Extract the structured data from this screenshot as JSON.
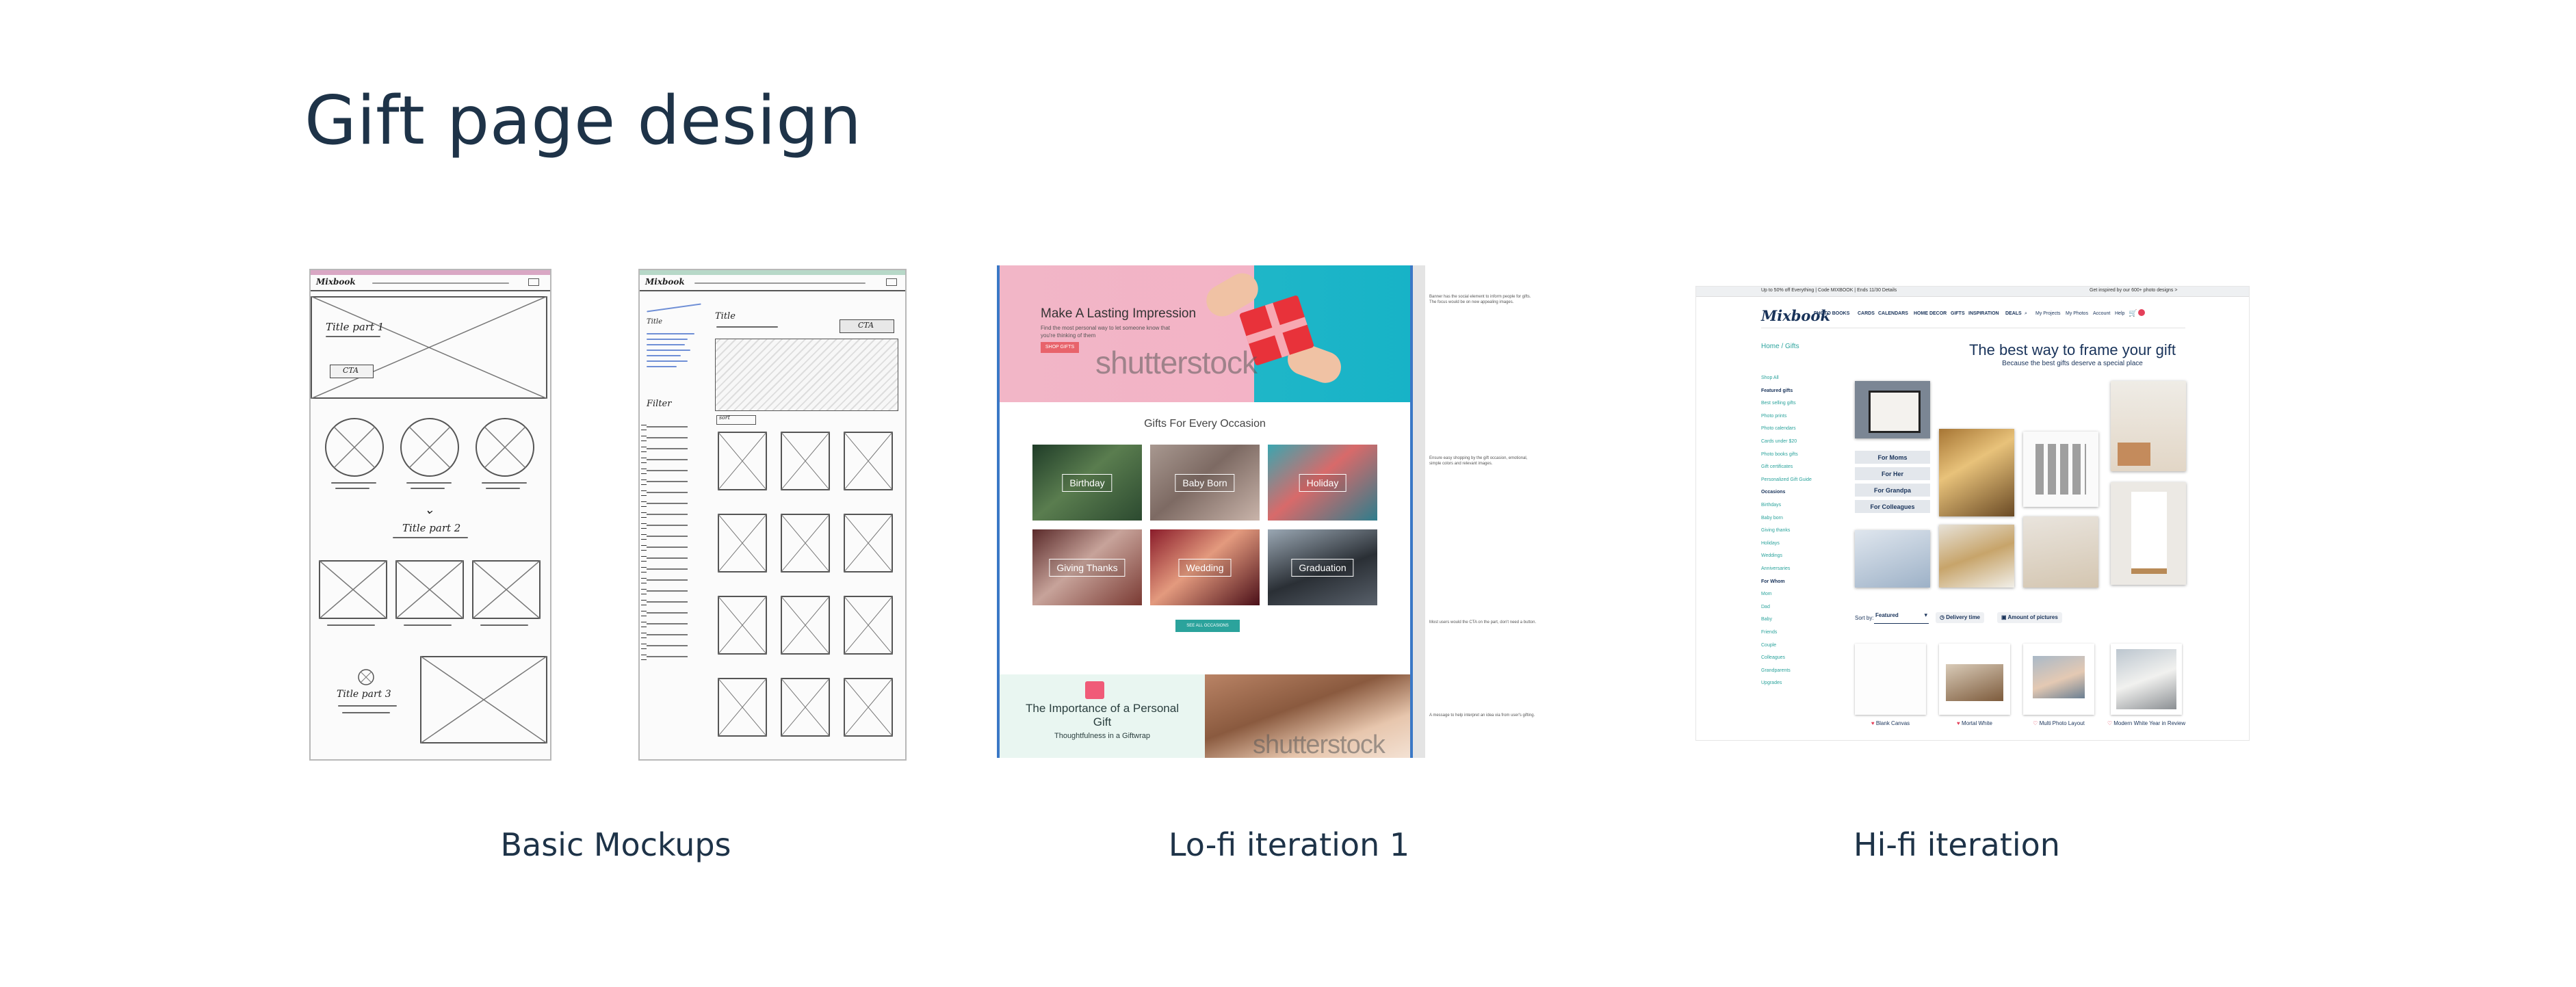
{
  "page": {
    "title": "Gift page design"
  },
  "captions": [
    "Basic Mockups",
    "Lo-fi iteration 1",
    "Hi-fi iteration"
  ],
  "mockups": {
    "a": {
      "logo": "Mixbook",
      "title1": "Title part 1",
      "cta": "CTA",
      "title2": "Title part 2",
      "title3": "Title part 3"
    },
    "b": {
      "logo": "Mixbook",
      "side_title": "Title",
      "title": "Title",
      "cta": "CTA",
      "filter": "Filter",
      "sort": "sort"
    }
  },
  "lofi": {
    "hero_title": "Make A Lasting Impression",
    "hero_sub": "Find the most personal way to let someone know that you're thinking of them",
    "hero_btn": "SHOP GIFTS",
    "watermark": "shutterstock",
    "occasions_title": "Gifts For Every Occasion",
    "occasions": [
      "Birthday",
      "Baby Born",
      "Holiday",
      "Giving Thanks",
      "Wedding",
      "Graduation"
    ],
    "all_btn": "SEE ALL OCCASIONS",
    "importance_title": "The Importance of a Personal Gift",
    "importance_sub": "Thoughtfulness in a Giftwrap",
    "notes": [
      "Banner has the social element to inform people for gifts. The focus would be on new appealing images.",
      "Ensure easy shopping by the gift occasion, emotional, simple colors and relevant images.",
      "Most users would the CTA on the part, don't need a button.",
      "A message to help interpret an idea via from user's gifting."
    ]
  },
  "hifi": {
    "topbar_left": "Up to 50% off Everything | Code MIXBOOK | Ends 11/30 Details",
    "topbar_right": "Get inspired by our 600+ photo designs >",
    "logo": "Mixbook",
    "nav": [
      "PHOTO BOOKS",
      "CARDS",
      "CALENDARS",
      "HOME DECOR",
      "GIFTS",
      "INSPIRATION",
      "DEALS"
    ],
    "util": [
      "My Projects",
      "My Photos",
      "Account",
      "Help"
    ],
    "breadcrumb": "Home / Gifts",
    "heading": "The best way to frame your gift",
    "subheading": "Because the best gifts deserve a special place",
    "sidebar": [
      {
        "t": "Shop All",
        "hd": false
      },
      {
        "t": "Featured gifts",
        "hd": true
      },
      {
        "t": "Best selling gifts",
        "hd": false
      },
      {
        "t": "Photo prints",
        "hd": false
      },
      {
        "t": "Photo calendars",
        "hd": false
      },
      {
        "t": "Cards under $20",
        "hd": false
      },
      {
        "t": "Photo books gifts",
        "hd": false
      },
      {
        "t": "Gift certificates",
        "hd": false
      },
      {
        "t": "Personalized Gift Guide",
        "hd": false
      },
      {
        "t": "Occasions",
        "hd": true
      },
      {
        "t": "Birthdays",
        "hd": false
      },
      {
        "t": "Baby born",
        "hd": false
      },
      {
        "t": "Giving thanks",
        "hd": false
      },
      {
        "t": "Holidays",
        "hd": false
      },
      {
        "t": "Weddings",
        "hd": false
      },
      {
        "t": "Anniversaries",
        "hd": false
      },
      {
        "t": "For Whom",
        "hd": true
      },
      {
        "t": "Mom",
        "hd": false
      },
      {
        "t": "Dad",
        "hd": false
      },
      {
        "t": "Baby",
        "hd": false
      },
      {
        "t": "Friends",
        "hd": false
      },
      {
        "t": "Couple",
        "hd": false
      },
      {
        "t": "Colleagues",
        "hd": false
      },
      {
        "t": "Grandparents",
        "hd": false
      },
      {
        "t": "Upgrades",
        "hd": false
      }
    ],
    "for_buttons": [
      "For Moms",
      "For Her",
      "For Grandpa",
      "For Colleagues"
    ],
    "sort_label": "Sort by:",
    "sort_value": "Featured",
    "filter_pills": [
      "Delivery time",
      "Amount of pictures"
    ],
    "products": [
      "Blank Canvas",
      "Mortal White",
      "Multi Photo Layout",
      "Modern White Year in Review"
    ]
  },
  "colors": {
    "heading": "#1e3348",
    "accent_teal": "#2ba39c",
    "lofi_frame": "#3a78c6",
    "navy": "#19335a"
  }
}
